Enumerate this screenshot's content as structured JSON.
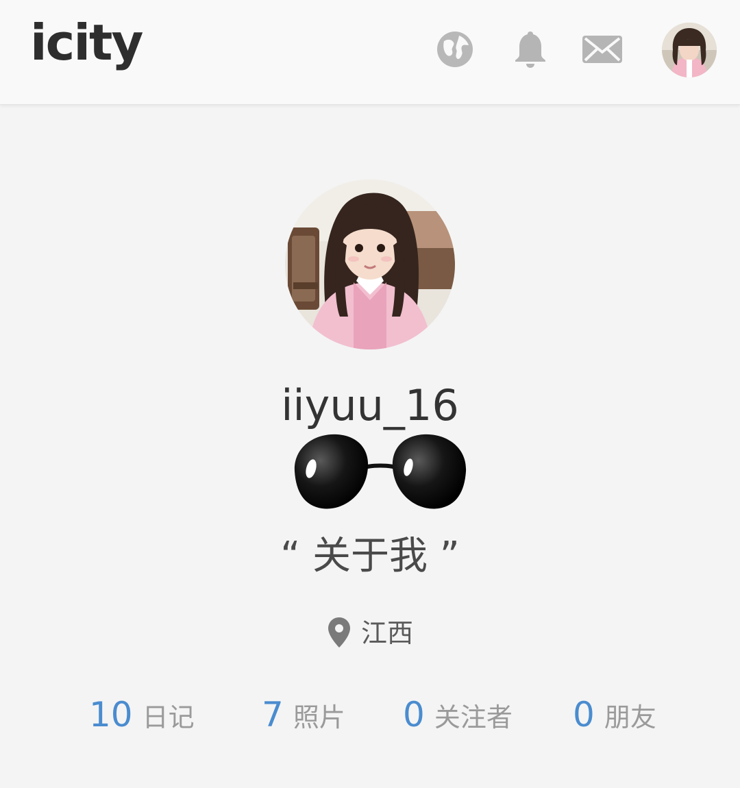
{
  "header": {
    "logo": "icity",
    "icons": [
      "globe-icon",
      "bell-icon",
      "mail-icon"
    ]
  },
  "profile": {
    "username": "iiyuu_16",
    "about": "“ 关于我 ”",
    "location": "江西"
  },
  "stats": [
    {
      "value": "10",
      "label": "日记"
    },
    {
      "value": "7",
      "label": "照片"
    },
    {
      "value": "0",
      "label": "关注者"
    },
    {
      "value": "0",
      "label": "朋友"
    }
  ],
  "colors": {
    "accent": "#4a8ccf",
    "icon_gray": "#b5b5b5",
    "background": "#f4f4f4"
  }
}
